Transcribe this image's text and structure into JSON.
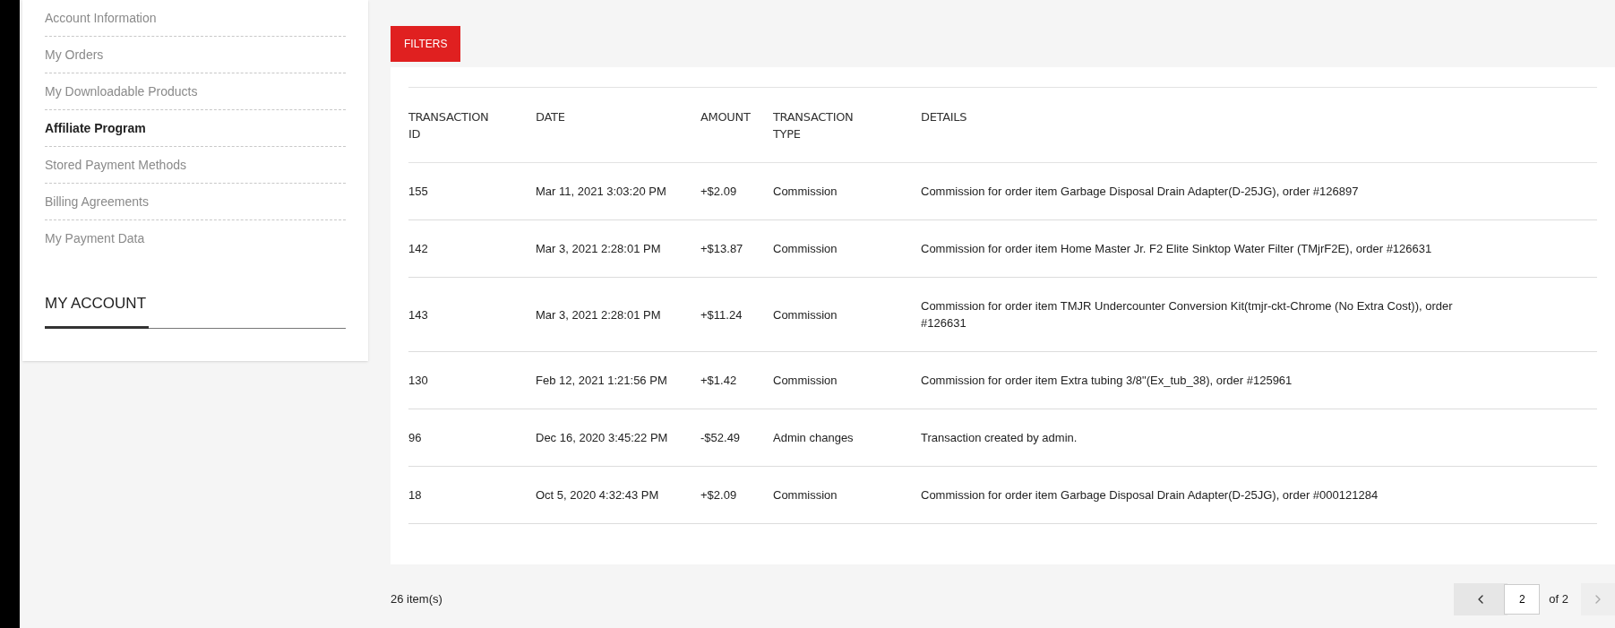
{
  "sidebar": {
    "items": [
      {
        "label": "Account Information",
        "selected": false
      },
      {
        "label": "My Orders",
        "selected": false
      },
      {
        "label": "My Downloadable Products",
        "selected": false
      },
      {
        "label": "Affiliate Program",
        "selected": true
      },
      {
        "label": "Stored Payment Methods",
        "selected": false
      },
      {
        "label": "Billing Agreements",
        "selected": false
      },
      {
        "label": "My Payment Data",
        "selected": false
      }
    ],
    "section_title": "MY ACCOUNT"
  },
  "filters_button": "FILTERS",
  "table": {
    "columns": [
      "TRANSACTION ID",
      "DATE",
      "AMOUNT",
      "TRANSACTION TYPE",
      "DETAILS"
    ],
    "rows": [
      [
        "155",
        "Mar 11, 2021 3:03:20 PM",
        "+$2.09",
        "Commission",
        "Commission for order item Garbage Disposal Drain Adapter(D-25JG), order #126897"
      ],
      [
        "142",
        "Mar 3, 2021 2:28:01 PM",
        "+$13.87",
        "Commission",
        "Commission for order item Home Master Jr. F2 Elite Sinktop Water Filter (TMjrF2E), order #126631"
      ],
      [
        "143",
        "Mar 3, 2021 2:28:01 PM",
        "+$11.24",
        "Commission",
        "Commission for order item TMJR Undercounter Conversion Kit(tmjr-ckt-Chrome (No Extra Cost)), order #126631"
      ],
      [
        "130",
        "Feb 12, 2021 1:21:56 PM",
        "+$1.42",
        "Commission",
        "Commission for order item Extra tubing 3/8\"(Ex_tub_38), order #125961"
      ],
      [
        "96",
        "Dec 16, 2020 3:45:22 PM",
        "-$52.49",
        "Admin changes",
        "Transaction created by admin."
      ],
      [
        "18",
        "Oct 5, 2020 4:32:43 PM",
        "+$2.09",
        "Commission",
        "Commission for order item Garbage Disposal Drain Adapter(D-25JG), order #000121284"
      ]
    ]
  },
  "footer": {
    "count": "26 item(s)",
    "pager": {
      "page": "2",
      "of": "of 2",
      "prev_disabled": false,
      "next_disabled": true
    }
  }
}
